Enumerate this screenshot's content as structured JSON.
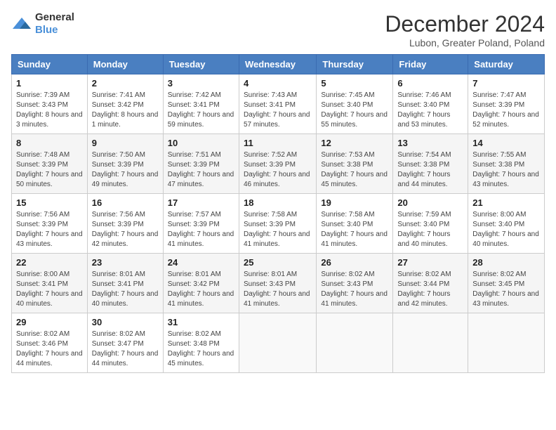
{
  "logo": {
    "general": "General",
    "blue": "Blue"
  },
  "title": "December 2024",
  "subtitle": "Lubon, Greater Poland, Poland",
  "days_header": [
    "Sunday",
    "Monday",
    "Tuesday",
    "Wednesday",
    "Thursday",
    "Friday",
    "Saturday"
  ],
  "weeks": [
    [
      {
        "day": "1",
        "sunrise": "Sunrise: 7:39 AM",
        "sunset": "Sunset: 3:43 PM",
        "daylight": "Daylight: 8 hours and 3 minutes."
      },
      {
        "day": "2",
        "sunrise": "Sunrise: 7:41 AM",
        "sunset": "Sunset: 3:42 PM",
        "daylight": "Daylight: 8 hours and 1 minute."
      },
      {
        "day": "3",
        "sunrise": "Sunrise: 7:42 AM",
        "sunset": "Sunset: 3:41 PM",
        "daylight": "Daylight: 7 hours and 59 minutes."
      },
      {
        "day": "4",
        "sunrise": "Sunrise: 7:43 AM",
        "sunset": "Sunset: 3:41 PM",
        "daylight": "Daylight: 7 hours and 57 minutes."
      },
      {
        "day": "5",
        "sunrise": "Sunrise: 7:45 AM",
        "sunset": "Sunset: 3:40 PM",
        "daylight": "Daylight: 7 hours and 55 minutes."
      },
      {
        "day": "6",
        "sunrise": "Sunrise: 7:46 AM",
        "sunset": "Sunset: 3:40 PM",
        "daylight": "Daylight: 7 hours and 53 minutes."
      },
      {
        "day": "7",
        "sunrise": "Sunrise: 7:47 AM",
        "sunset": "Sunset: 3:39 PM",
        "daylight": "Daylight: 7 hours and 52 minutes."
      }
    ],
    [
      {
        "day": "8",
        "sunrise": "Sunrise: 7:48 AM",
        "sunset": "Sunset: 3:39 PM",
        "daylight": "Daylight: 7 hours and 50 minutes."
      },
      {
        "day": "9",
        "sunrise": "Sunrise: 7:50 AM",
        "sunset": "Sunset: 3:39 PM",
        "daylight": "Daylight: 7 hours and 49 minutes."
      },
      {
        "day": "10",
        "sunrise": "Sunrise: 7:51 AM",
        "sunset": "Sunset: 3:39 PM",
        "daylight": "Daylight: 7 hours and 47 minutes."
      },
      {
        "day": "11",
        "sunrise": "Sunrise: 7:52 AM",
        "sunset": "Sunset: 3:39 PM",
        "daylight": "Daylight: 7 hours and 46 minutes."
      },
      {
        "day": "12",
        "sunrise": "Sunrise: 7:53 AM",
        "sunset": "Sunset: 3:38 PM",
        "daylight": "Daylight: 7 hours and 45 minutes."
      },
      {
        "day": "13",
        "sunrise": "Sunrise: 7:54 AM",
        "sunset": "Sunset: 3:38 PM",
        "daylight": "Daylight: 7 hours and 44 minutes."
      },
      {
        "day": "14",
        "sunrise": "Sunrise: 7:55 AM",
        "sunset": "Sunset: 3:38 PM",
        "daylight": "Daylight: 7 hours and 43 minutes."
      }
    ],
    [
      {
        "day": "15",
        "sunrise": "Sunrise: 7:56 AM",
        "sunset": "Sunset: 3:39 PM",
        "daylight": "Daylight: 7 hours and 43 minutes."
      },
      {
        "day": "16",
        "sunrise": "Sunrise: 7:56 AM",
        "sunset": "Sunset: 3:39 PM",
        "daylight": "Daylight: 7 hours and 42 minutes."
      },
      {
        "day": "17",
        "sunrise": "Sunrise: 7:57 AM",
        "sunset": "Sunset: 3:39 PM",
        "daylight": "Daylight: 7 hours and 41 minutes."
      },
      {
        "day": "18",
        "sunrise": "Sunrise: 7:58 AM",
        "sunset": "Sunset: 3:39 PM",
        "daylight": "Daylight: 7 hours and 41 minutes."
      },
      {
        "day": "19",
        "sunrise": "Sunrise: 7:58 AM",
        "sunset": "Sunset: 3:40 PM",
        "daylight": "Daylight: 7 hours and 41 minutes."
      },
      {
        "day": "20",
        "sunrise": "Sunrise: 7:59 AM",
        "sunset": "Sunset: 3:40 PM",
        "daylight": "Daylight: 7 hours and 40 minutes."
      },
      {
        "day": "21",
        "sunrise": "Sunrise: 8:00 AM",
        "sunset": "Sunset: 3:40 PM",
        "daylight": "Daylight: 7 hours and 40 minutes."
      }
    ],
    [
      {
        "day": "22",
        "sunrise": "Sunrise: 8:00 AM",
        "sunset": "Sunset: 3:41 PM",
        "daylight": "Daylight: 7 hours and 40 minutes."
      },
      {
        "day": "23",
        "sunrise": "Sunrise: 8:01 AM",
        "sunset": "Sunset: 3:41 PM",
        "daylight": "Daylight: 7 hours and 40 minutes."
      },
      {
        "day": "24",
        "sunrise": "Sunrise: 8:01 AM",
        "sunset": "Sunset: 3:42 PM",
        "daylight": "Daylight: 7 hours and 41 minutes."
      },
      {
        "day": "25",
        "sunrise": "Sunrise: 8:01 AM",
        "sunset": "Sunset: 3:43 PM",
        "daylight": "Daylight: 7 hours and 41 minutes."
      },
      {
        "day": "26",
        "sunrise": "Sunrise: 8:02 AM",
        "sunset": "Sunset: 3:43 PM",
        "daylight": "Daylight: 7 hours and 41 minutes."
      },
      {
        "day": "27",
        "sunrise": "Sunrise: 8:02 AM",
        "sunset": "Sunset: 3:44 PM",
        "daylight": "Daylight: 7 hours and 42 minutes."
      },
      {
        "day": "28",
        "sunrise": "Sunrise: 8:02 AM",
        "sunset": "Sunset: 3:45 PM",
        "daylight": "Daylight: 7 hours and 43 minutes."
      }
    ],
    [
      {
        "day": "29",
        "sunrise": "Sunrise: 8:02 AM",
        "sunset": "Sunset: 3:46 PM",
        "daylight": "Daylight: 7 hours and 44 minutes."
      },
      {
        "day": "30",
        "sunrise": "Sunrise: 8:02 AM",
        "sunset": "Sunset: 3:47 PM",
        "daylight": "Daylight: 7 hours and 44 minutes."
      },
      {
        "day": "31",
        "sunrise": "Sunrise: 8:02 AM",
        "sunset": "Sunset: 3:48 PM",
        "daylight": "Daylight: 7 hours and 45 minutes."
      },
      null,
      null,
      null,
      null
    ]
  ]
}
